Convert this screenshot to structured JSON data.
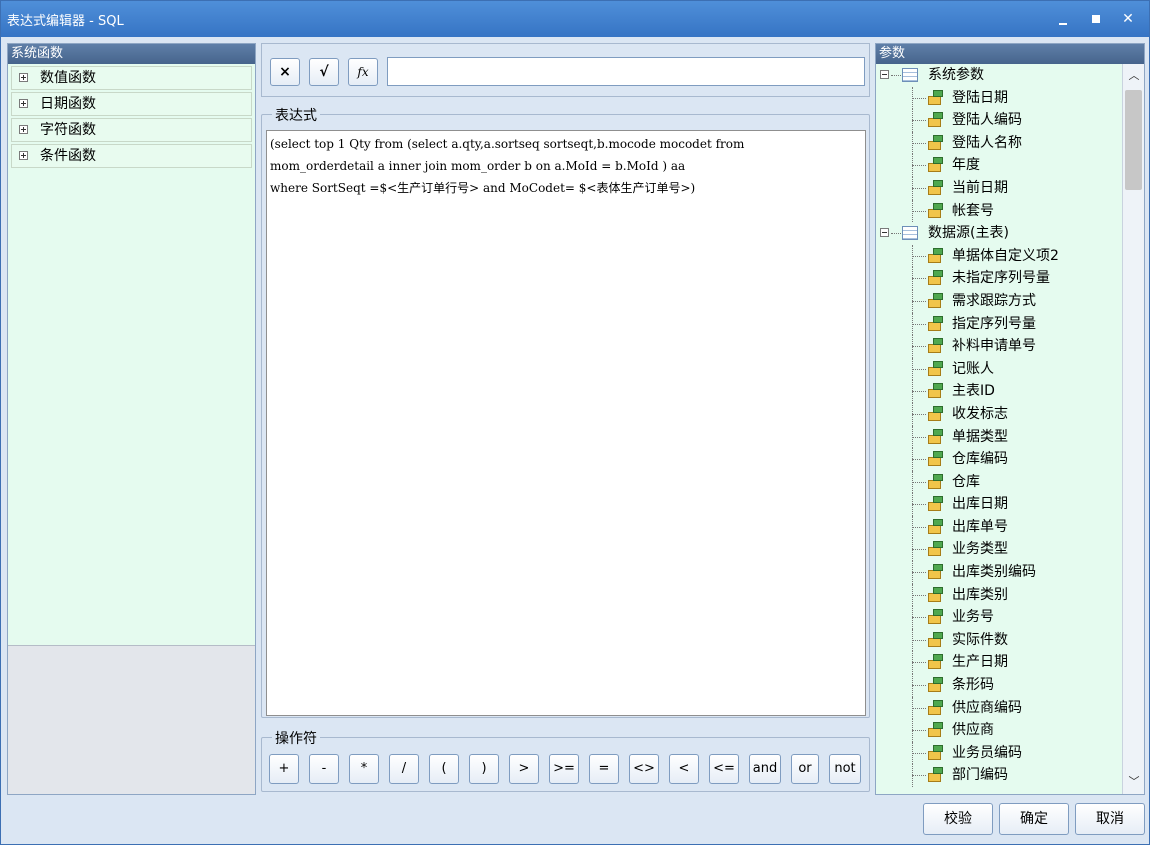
{
  "window": {
    "title": "表达式编辑器 - SQL"
  },
  "left_panel": {
    "header": "系统函数",
    "items": [
      {
        "label": "数值函数"
      },
      {
        "label": "日期函数"
      },
      {
        "label": "字符函数"
      },
      {
        "label": "条件函数"
      }
    ]
  },
  "toolbar": {
    "clear_label": "×",
    "check_label": "√",
    "fx_label": "fx",
    "formula_value": ""
  },
  "expression": {
    "group_label": "表达式",
    "text": "(select top 1 Qty from (select a.qty,a.sortseq sortseqt,b.mocode mocodet from\nmom_orderdetail a inner join mom_order b on a.MoId = b.MoId ) aa\nwhere SortSeqt =$<生产订单行号> and MoCodet= $<表体生产订单号>)"
  },
  "operators": {
    "group_label": "操作符",
    "buttons": [
      "+",
      "-",
      "*",
      "/",
      "(",
      ")",
      ">",
      ">=",
      "=",
      "<>",
      "<",
      "<=",
      "and",
      "or",
      "not"
    ]
  },
  "params": {
    "header": "参数",
    "groups": [
      {
        "label": "系统参数",
        "items": [
          "登陆日期",
          "登陆人编码",
          "登陆人名称",
          "年度",
          "当前日期",
          "帐套号"
        ]
      },
      {
        "label": "数据源(主表)",
        "items": [
          "单据体自定义项2",
          "未指定序列号量",
          "需求跟踪方式",
          "指定序列号量",
          "补料申请单号",
          "记账人",
          "主表ID",
          "收发标志",
          "单据类型",
          "仓库编码",
          "仓库",
          "出库日期",
          "出库单号",
          "业务类型",
          "出库类别编码",
          "出库类别",
          "业务号",
          "实际件数",
          "生产日期",
          "条形码",
          "供应商编码",
          "供应商",
          "业务员编码",
          "部门编码"
        ]
      }
    ]
  },
  "dialog": {
    "validate_label": "校验",
    "ok_label": "确定",
    "cancel_label": "取消"
  },
  "colors": {
    "titlebar": "#3674c4",
    "panel_bg": "#e5fbef",
    "window_bg": "#dbe6f3"
  }
}
